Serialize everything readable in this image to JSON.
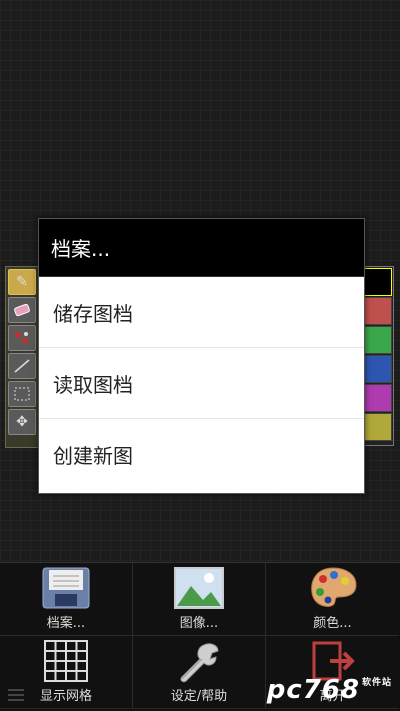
{
  "dialog": {
    "title": "档案...",
    "items": [
      "储存图档",
      "读取图档",
      "创建新图"
    ]
  },
  "tools": [
    "pencil-icon",
    "eraser-icon",
    "fill-icon",
    "line-icon",
    "select-icon",
    "move-icon"
  ],
  "colors": [
    "#000000",
    "#c0504d",
    "#3aa84a",
    "#2d56b0",
    "#b03ab0",
    "#b0a838"
  ],
  "bottom": {
    "file_label": "档案...",
    "image_label": "图像...",
    "color_label": "颜色...",
    "grid_label": "显示网格",
    "settings_label": "设定/帮助",
    "exit_label": "离开"
  },
  "watermark": {
    "brand": "pc768",
    "sub": "软件站"
  }
}
